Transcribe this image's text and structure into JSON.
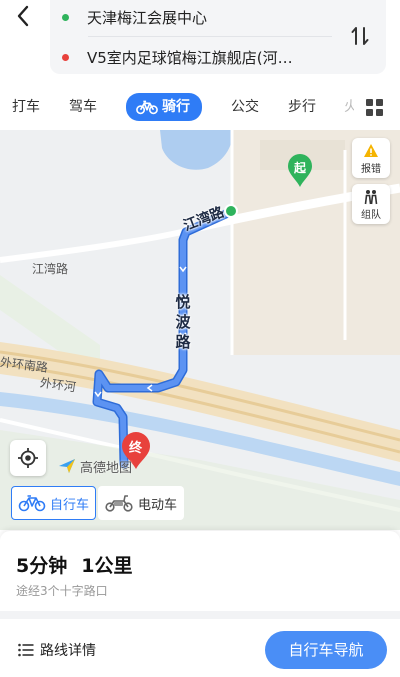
{
  "route": {
    "start": "天津梅江会展中心",
    "end": "V5室内足球馆梅江旗舰店(河…",
    "start_color": "#2fb35c",
    "end_color": "#e8413c"
  },
  "tabs": [
    {
      "label": "打车",
      "active": false
    },
    {
      "label": "驾车",
      "active": false
    },
    {
      "label": "骑行",
      "active": true
    },
    {
      "label": "公交",
      "active": false
    },
    {
      "label": "步行",
      "active": false
    },
    {
      "label": "火",
      "active": false
    }
  ],
  "map": {
    "roads": {
      "jiangwan_top": "江湾路",
      "jiangwan_left": "江湾路",
      "yuebo": "悦波路",
      "outer_ring_south": "外环南路",
      "outer_ring_river": "外环河"
    },
    "markers": {
      "start": "起",
      "end": "终"
    },
    "side_buttons": {
      "report": "报错",
      "team": "组队"
    },
    "logo": "高德地图",
    "route_color": "#4a86f0",
    "accent_color": "#2f7cf6"
  },
  "vehicles": [
    {
      "label": "自行车",
      "active": true
    },
    {
      "label": "电动车",
      "active": false
    }
  ],
  "summary": {
    "time": "5分钟",
    "distance": "1公里",
    "subtitle": "途经3个十字路口"
  },
  "footer": {
    "details": "路线详情",
    "navigate": "自行车导航"
  }
}
